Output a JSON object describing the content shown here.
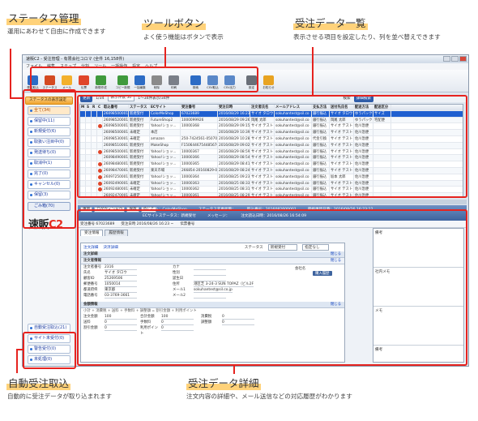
{
  "callouts": {
    "status": {
      "title": "ステータス管理",
      "desc": "運用にあわせて自由に作成できます"
    },
    "toolbar": {
      "title": "ツールボタン",
      "desc": "よく使う機能はボタンで表示"
    },
    "list": {
      "title": "受注データ一覧",
      "desc": "表示させる項目を設定したり、列を並べ替えできます"
    },
    "import": {
      "title": "自動受注取込",
      "desc": "自動的に受注データが取り込まれます"
    },
    "detail": {
      "title": "受注データ詳細",
      "desc": "注文内容の詳細や、メール送信などの対応履歴がわかります"
    }
  },
  "window": {
    "title": "速販C2 - 受注管理 - 有限会社コロマ (全件 16,158件)",
    "menu": [
      "ファイル",
      "編集",
      "ステップ",
      "分割",
      "ツール",
      "一括操作",
      "設定",
      "ヘルプ"
    ],
    "toolbar": [
      "受注取込",
      "ステータス",
      "メール",
      "伝票",
      "新規作成",
      "コピー新規",
      "一括編集",
      "削除",
      "印刷",
      "検索",
      "CSV取込",
      "CSV出力",
      "設定",
      "お知らせ"
    ],
    "colors": [
      "#2d6cc5",
      "#d44a22",
      "#f3b02c",
      "#e0462a",
      "#3f9a3c",
      "#3f9a3c",
      "#2d6cc5",
      "#8a8a8a",
      "#7a7f88",
      "#2d6cc5",
      "#5a88c8",
      "#5a88c8",
      "#6a6f78",
      "#e8a321"
    ]
  },
  "sidebar": {
    "header": "ステータスの表示設定",
    "items": [
      "全て(34)",
      "保留中(11)",
      "新規受付(6)",
      "取扱い注目中(0)",
      "発送待ち(0)",
      "取消中(1)",
      "完了(0)",
      "キャンセル(0)",
      "保留(3)"
    ],
    "all": "ごみ箱(70)",
    "logo_text": "速販",
    "logo_mark": "C2",
    "bottom": [
      "自動受注取込(21)",
      "サイト未受付(0)",
      "警告受付(0)",
      "未処理(0)"
    ]
  },
  "list": {
    "bar": [
      "更新",
      "1/34",
      "表示件数 50",
      "1〜34件表示/34件",
      "検索",
      "詳細検索"
    ],
    "headers": [
      "M",
      "S",
      "R",
      "C",
      "取込番号",
      "ステータス",
      "ECサイト",
      "受注番号",
      "受注日時",
      "注文者氏名",
      "メールアドレス",
      "支払方法",
      "送付先氏名",
      "配送方法",
      "配送区分"
    ],
    "rows": [
      [
        "",
        "",
        "",
        "",
        "26098500001",
        "新規受付",
        "ColorMeShop",
        "67023689",
        "2016/08/29 16:23",
        "サイオ タロウ",
        "sokuhantest@sil.co",
        "銀行振込",
        "サイオ タロウ",
        "ゆうパック",
        "サイズ"
      ],
      [
        "",
        "",
        "",
        "",
        "26098520001",
        "新規受付",
        "FutureShop2",
        "1000099926",
        "2016/08/29 09:26",
        "岡尾 太郎",
        "sokuhantest@sil.co",
        "銀行振込",
        "岡尾 太郎",
        "ゆうパック",
        "宅配便"
      ],
      [
        "",
        "",
        "",
        "●",
        "26098500001",
        "新規受付",
        "Yahoo!ショッ...",
        "10000368",
        "2016/08/29 09:15",
        "サイオ テスト",
        "sokuhantest@sil.co",
        "銀行振込",
        "サイオ テスト",
        "佐川急便",
        ""
      ],
      [
        "",
        "",
        "",
        "",
        "26098500001",
        "未確定",
        "本店",
        "",
        "2016/08/29 10:39",
        "サイオ テスト",
        "sokuhantest@sil.co",
        "銀行振込",
        "サイオ テスト",
        "佐川急便",
        ""
      ],
      [
        "",
        "",
        "",
        "",
        "26098530001",
        "未確定",
        "amazon",
        "250-7424561-0507000",
        "2016/08/29 10:28",
        "サイオ テスト",
        "sokuhantest@sil.co",
        "代金引換",
        "サイオ テスト",
        "佐川急便",
        ""
      ],
      [
        "",
        "",
        "",
        "",
        "26098510001",
        "新規受付",
        "MakeShop",
        "F1506446754485670",
        "2016/08/29 09:02",
        "サイオ テスト",
        "sokuhantest@sil.co",
        "銀行振込",
        "サイオ テスト",
        "佐川急便",
        ""
      ],
      [
        "",
        "",
        "",
        "●",
        "26098500001",
        "新規受付",
        "Yahoo!ショッ...",
        "10000367",
        "2016/08/29 08:59",
        "サイオ テスト",
        "sokuhantest@sil.co",
        "銀行振込",
        "サイオ テスト",
        "佐川急便",
        ""
      ],
      [
        "",
        "",
        "",
        "",
        "26098490001",
        "新規受付",
        "Yahoo!ショッ...",
        "10000366",
        "2016/08/29 08:54",
        "サイオ テスト",
        "sokuhantest@sil.co",
        "銀行振込",
        "サイオ テスト",
        "佐川急便",
        ""
      ],
      [
        "",
        "",
        "",
        "●",
        "26098480001",
        "新規受付",
        "Yahoo!ショッ...",
        "10000365",
        "2016/08/29 08:41",
        "サイオ テスト",
        "sokuhantest@sil.co",
        "銀行振込",
        "サイオ テスト",
        "佐川急便",
        ""
      ],
      [
        "",
        "",
        "",
        "●",
        "26098470001",
        "新規受付",
        "楽天市場",
        "266854-20160829-0251...",
        "2016/08/29 08:24",
        "サイオ テスト",
        "sokuhantest@sil.co",
        "銀行振込",
        "サイオ テスト",
        "佐川急便",
        ""
      ],
      [
        "",
        "",
        "",
        "●",
        "26097250001",
        "新規受付",
        "Yahoo!ショッ...",
        "10000364",
        "2016/08/25 09:23",
        "サイオ テスト",
        "sokuhantest@sil.co",
        "銀行振込",
        "坂本 太郎",
        "佐川急便",
        ""
      ],
      [
        "",
        "",
        "",
        "●",
        "26092490001",
        "未確定",
        "Yahoo!ショッ...",
        "10000363",
        "2016/08/25 08:33",
        "サイオ テスト",
        "sokuhantest@sil.co",
        "銀行振込",
        "サイオ テスト",
        "佐川急便",
        ""
      ],
      [
        "",
        "",
        "",
        "●",
        "26092480001",
        "未確定",
        "Yahoo!ショッ...",
        "10000362",
        "2016/08/25 08:31",
        "サイオ テスト",
        "sokuhantest@sil.co",
        "銀行振込",
        "サイオ テスト",
        "佐川急便",
        ""
      ],
      [
        "",
        "",
        "",
        "",
        "26092470001",
        "未確定",
        "Yahoo!ショッ...",
        "10000361",
        "2016/08/25 08:29",
        "サイオ テスト",
        "sokuhantest@sil.co",
        "銀行振込",
        "サイオ テスト",
        "佐川急便",
        ""
      ]
    ]
  },
  "detail": {
    "top_buttons": [
      "更新",
      "ログウィンドウ",
      "保存",
      "閉じる"
    ],
    "top_info": [
      "ECサイト：ColorMeShop",
      "ステータス変更状態：",
      "取込番号：2016082600001",
      "最終更新日時：2016/08/26 16:23:12"
    ],
    "top_info2": [
      "ECサイトステータス：新規受付",
      "メッセージ：",
      "注文読込日時：2016/08/26 16:54:09"
    ],
    "line2": [
      "受注番号 67023689",
      "受注日時 2016/08/26 16:23 ~",
      "伝票番号"
    ],
    "tabs": [
      "受注情報",
      "履歴情報"
    ],
    "subtabs": [
      "注文詳細",
      "決済詳細"
    ],
    "status_label": "ステータス",
    "status_value": "新規受付",
    "status_value2": "指定なし",
    "sec1": "注文詳細",
    "sec1b": "注文者情報",
    "link": "閉じる",
    "fields": [
      [
        "注文者番号",
        "2316"
      ],
      [
        "氏名",
        "サイオ タロウ"
      ],
      [
        "顧客ID",
        "25269506"
      ],
      [
        "郵便番号",
        "1050014"
      ],
      [
        "都道府県",
        "東京都"
      ],
      [
        "電話番号",
        "03-3769-3661"
      ]
    ],
    "fields_r": [
      [
        "カナ",
        ""
      ],
      [
        "性別",
        ""
      ],
      [
        "誕生日",
        ""
      ],
      [
        "住所",
        "港区芝 3-24-3 SUN TOPAZ（ビル2F"
      ],
      [
        "メール1",
        "sokuhantest@sil.co.jp"
      ],
      [
        "メール2",
        ""
      ]
    ],
    "company_label": "会社名",
    "import_button": "購入履歴",
    "sec2": "金額情報",
    "amount_note": "小計 + 消費税 + 送料 + 手数料 + 調整額 = 割引金額 + 利用ポイント",
    "amounts": [
      [
        "注文金額",
        "100"
      ],
      [
        "送料",
        "0"
      ],
      [
        "割引金額",
        "0"
      ]
    ],
    "amounts_r": [
      [
        "合計金額",
        "100"
      ],
      [
        "手数料",
        "0"
      ],
      [
        "利用ポイント",
        "0"
      ]
    ],
    "amounts_r2": [
      [
        "消費税",
        "0"
      ],
      [
        "調整額",
        "0"
      ]
    ],
    "memo_labels": [
      "備考",
      "社内メモ",
      "メモ",
      "備考"
    ]
  }
}
